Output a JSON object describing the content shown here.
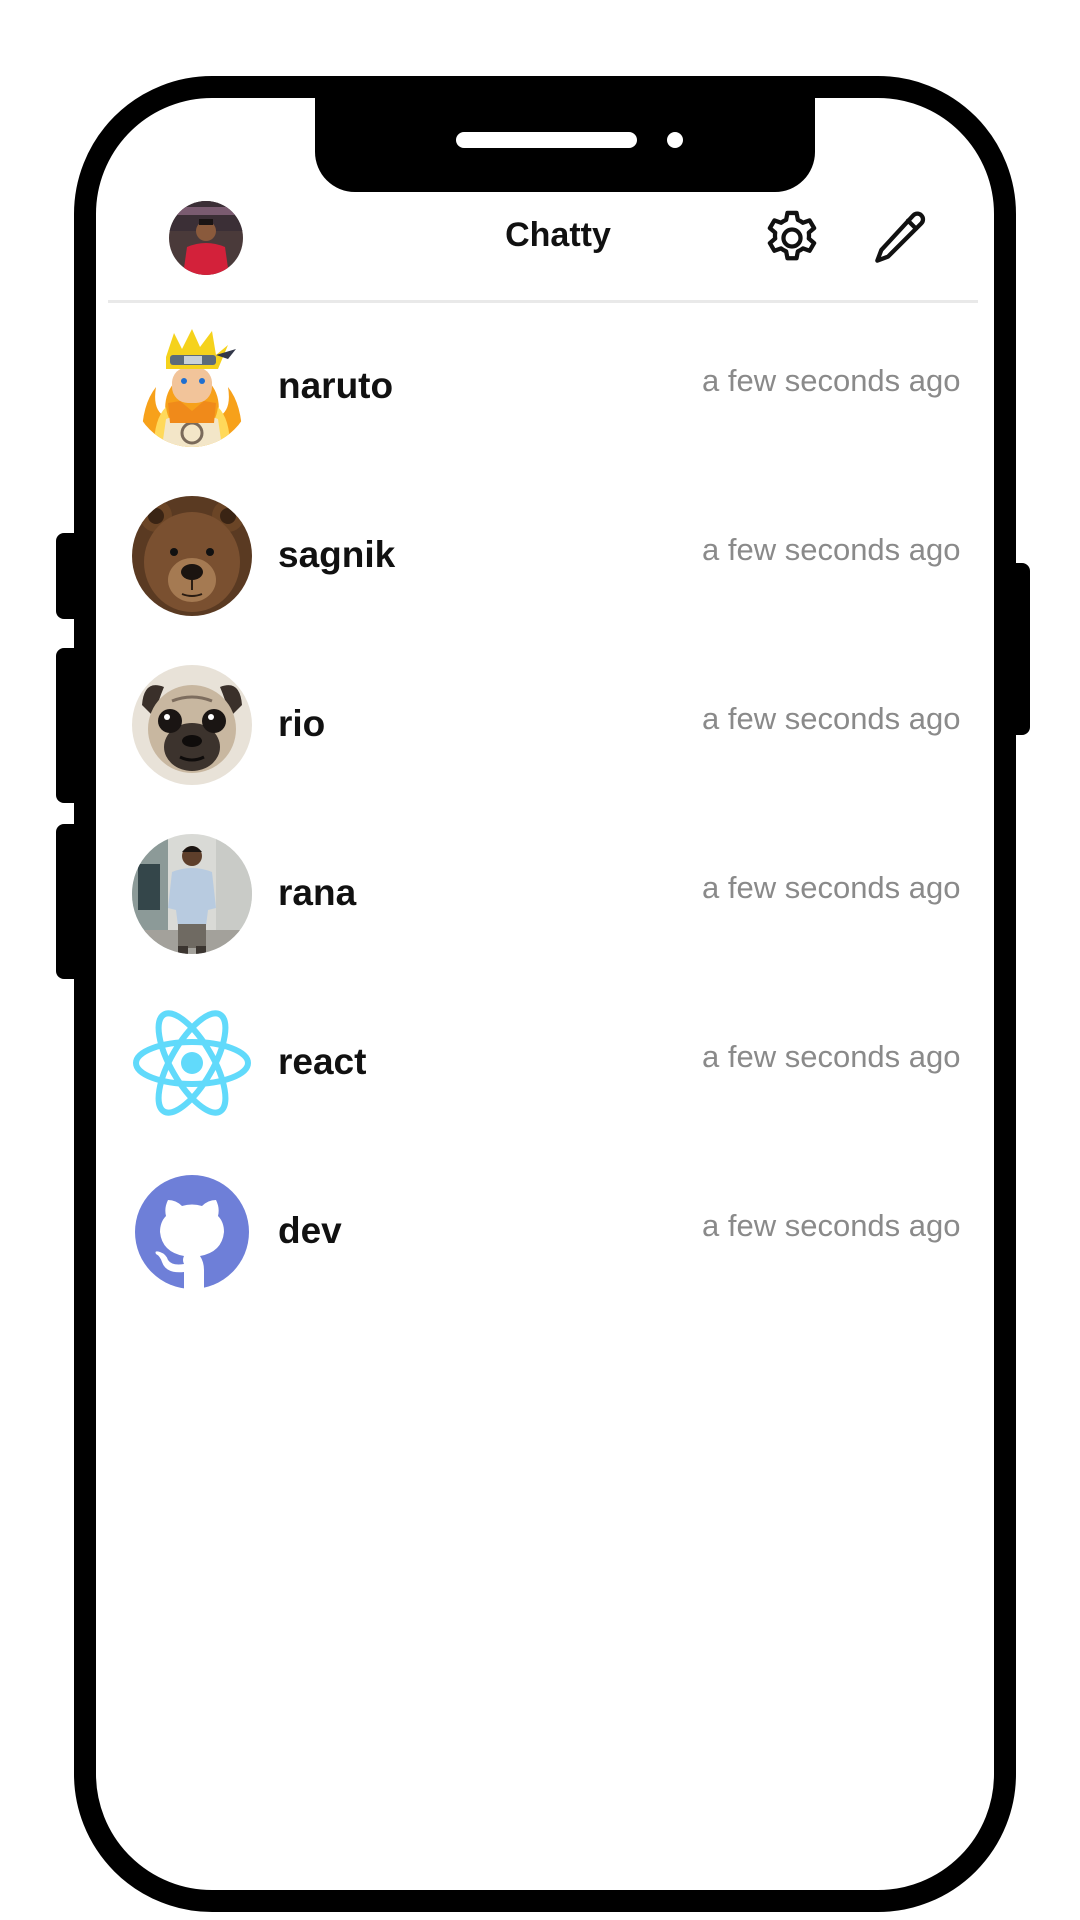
{
  "app": {
    "title": "Chatty",
    "profile_avatar": "profile-photo",
    "settings_icon": "gear-icon",
    "compose_icon": "pencil-icon"
  },
  "chats": [
    {
      "name": "naruto",
      "time": "a few seconds ago",
      "avatar": "naruto-avatar"
    },
    {
      "name": "sagnik",
      "time": "a few seconds ago",
      "avatar": "bear-avatar"
    },
    {
      "name": "rio",
      "time": "a few seconds ago",
      "avatar": "pug-avatar"
    },
    {
      "name": "rana",
      "time": "a few seconds ago",
      "avatar": "person-photo-avatar"
    },
    {
      "name": "react",
      "time": "a few seconds ago",
      "avatar": "react-logo-avatar"
    },
    {
      "name": "dev",
      "time": "a few seconds ago",
      "avatar": "github-logo-avatar"
    }
  ],
  "colors": {
    "react": "#61dafb",
    "github": "#6e7fd8",
    "divider": "#e9e9e9",
    "time_text": "#8a8a8a"
  }
}
